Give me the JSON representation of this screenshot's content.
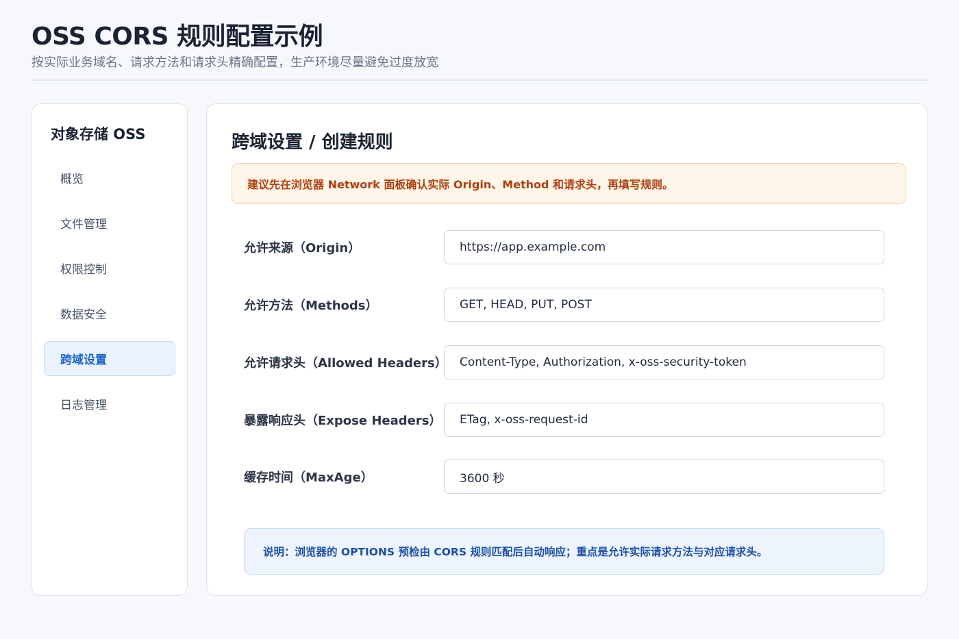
{
  "header": {
    "title": "OSS CORS 规则配置示例",
    "subtitle": "按实际业务域名、请求方法和请求头精确配置，生产环境尽量避免过度放宽"
  },
  "sidebar": {
    "title": "对象存储 OSS",
    "items": [
      {
        "label": "概览",
        "active": false
      },
      {
        "label": "文件管理",
        "active": false
      },
      {
        "label": "权限控制",
        "active": false
      },
      {
        "label": "数据安全",
        "active": false
      },
      {
        "label": "跨域设置",
        "active": true
      },
      {
        "label": "日志管理",
        "active": false
      }
    ]
  },
  "main": {
    "title": "跨域设置 / 创建规则",
    "warning": "建议先在浏览器 Network 面板确认实际 Origin、Method 和请求头，再填写规则。",
    "fields": [
      {
        "label": "允许来源（Origin）",
        "value": "https://app.example.com"
      },
      {
        "label": "允许方法（Methods）",
        "value": "GET, HEAD, PUT, POST"
      },
      {
        "label": "允许请求头（Allowed Headers）",
        "value": "Content-Type, Authorization, x-oss-security-token"
      },
      {
        "label": "暴露响应头（Expose Headers）",
        "value": "ETag, x-oss-request-id"
      },
      {
        "label": "缓存时间（MaxAge）",
        "value": "3600 秒"
      }
    ],
    "note": "说明：浏览器的 OPTIONS 预检由 CORS 规则匹配后自动响应；重点是允许实际请求方法与对应请求头。"
  },
  "colors": {
    "accent": "#1b63c8",
    "warning_text": "#b1400f",
    "warning_bg": "#fff6ea",
    "note_bg": "#edf4fe"
  }
}
